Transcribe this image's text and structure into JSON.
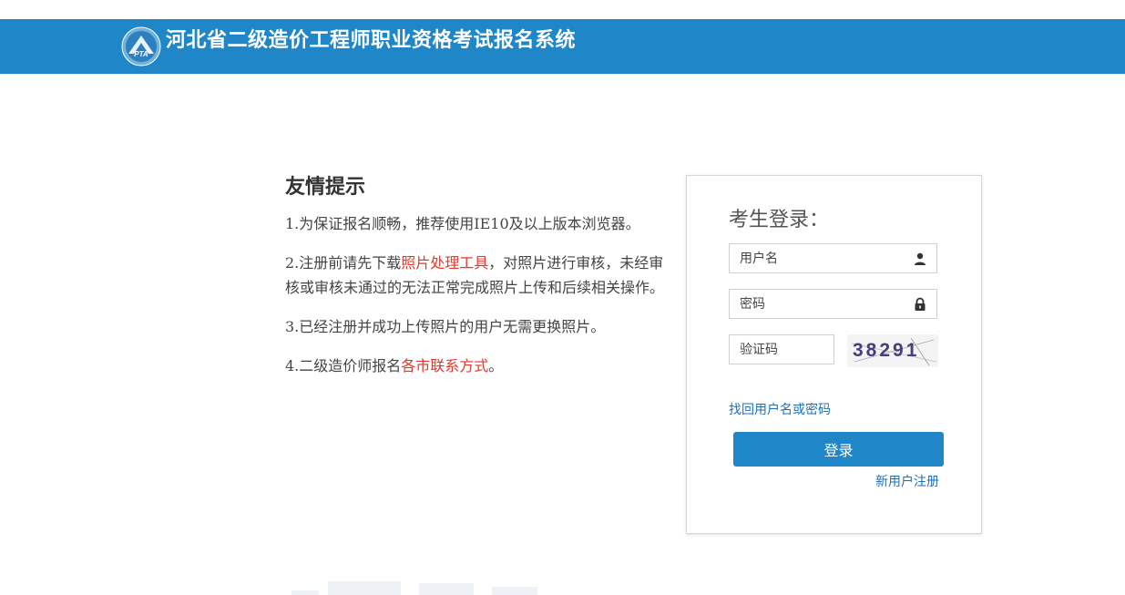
{
  "header": {
    "title": "河北省二级造价工程师职业资格考试报名系统",
    "logo_text": "PTA"
  },
  "notice": {
    "title": "友情提示",
    "items": [
      {
        "text": "1.为保证报名顺畅，推荐使用IE10及以上版本浏览器。"
      },
      {
        "prefix": "2.注册前请先下载",
        "link": "照片处理工具",
        "suffix": "，对照片进行审核，未经审核或审核未通过的无法正常完成照片上传和后续相关操作。"
      },
      {
        "text": "3.已经注册并成功上传照片的用户无需更换照片。"
      },
      {
        "prefix": "4.二级造价师报名",
        "link": "各市联系方式",
        "suffix": "。"
      }
    ]
  },
  "login": {
    "title": "考生登录：",
    "username_placeholder": "用户名",
    "password_placeholder": "密码",
    "captcha_placeholder": "验证码",
    "captcha_code": "38291",
    "forgot_link": "找回用户名或密码",
    "login_button": "登录",
    "register_link": "新用户注册"
  },
  "colors": {
    "brand": "#1f86c8",
    "link_red": "#e03a2d",
    "link_blue": "#1f6fb8"
  }
}
